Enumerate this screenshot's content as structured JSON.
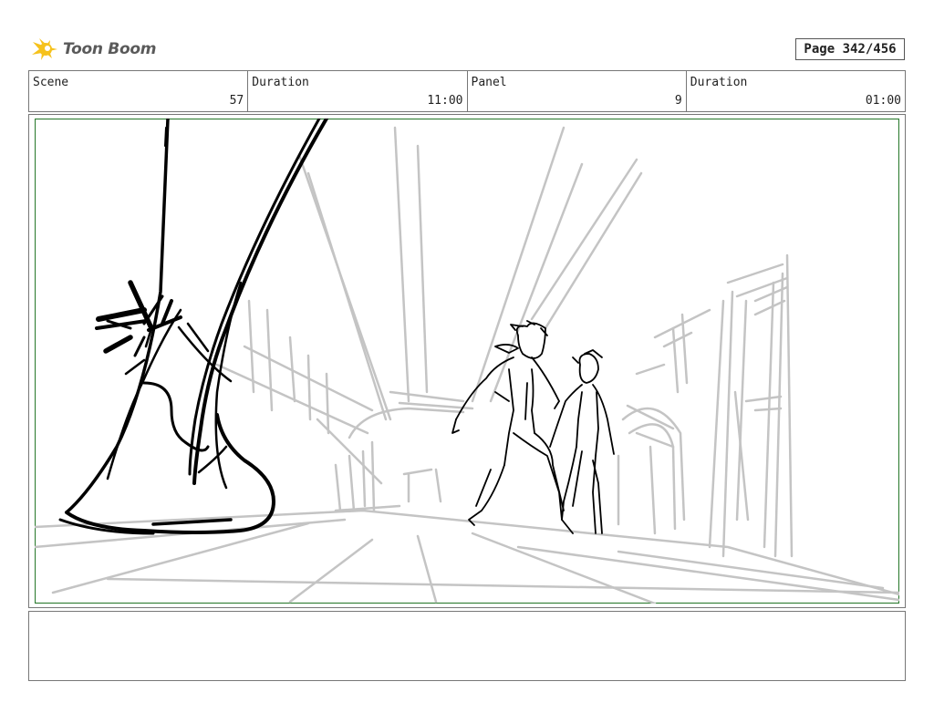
{
  "header": {
    "brand": "Toon Boom",
    "page_label": "Page 342/456"
  },
  "info": {
    "scene_label": "Scene",
    "scene_value": "57",
    "scene_duration_label": "Duration",
    "scene_duration_value": "11:00",
    "panel_label": "Panel",
    "panel_value": "9",
    "panel_duration_label": "Duration",
    "panel_duration_value": "01:00"
  },
  "notes": {
    "text": ""
  },
  "colors": {
    "panel_border": "#2e7d32",
    "sketch_grey": "#c4c4c4",
    "ink": "#000000",
    "logo_yellow": "#f6c21c"
  }
}
